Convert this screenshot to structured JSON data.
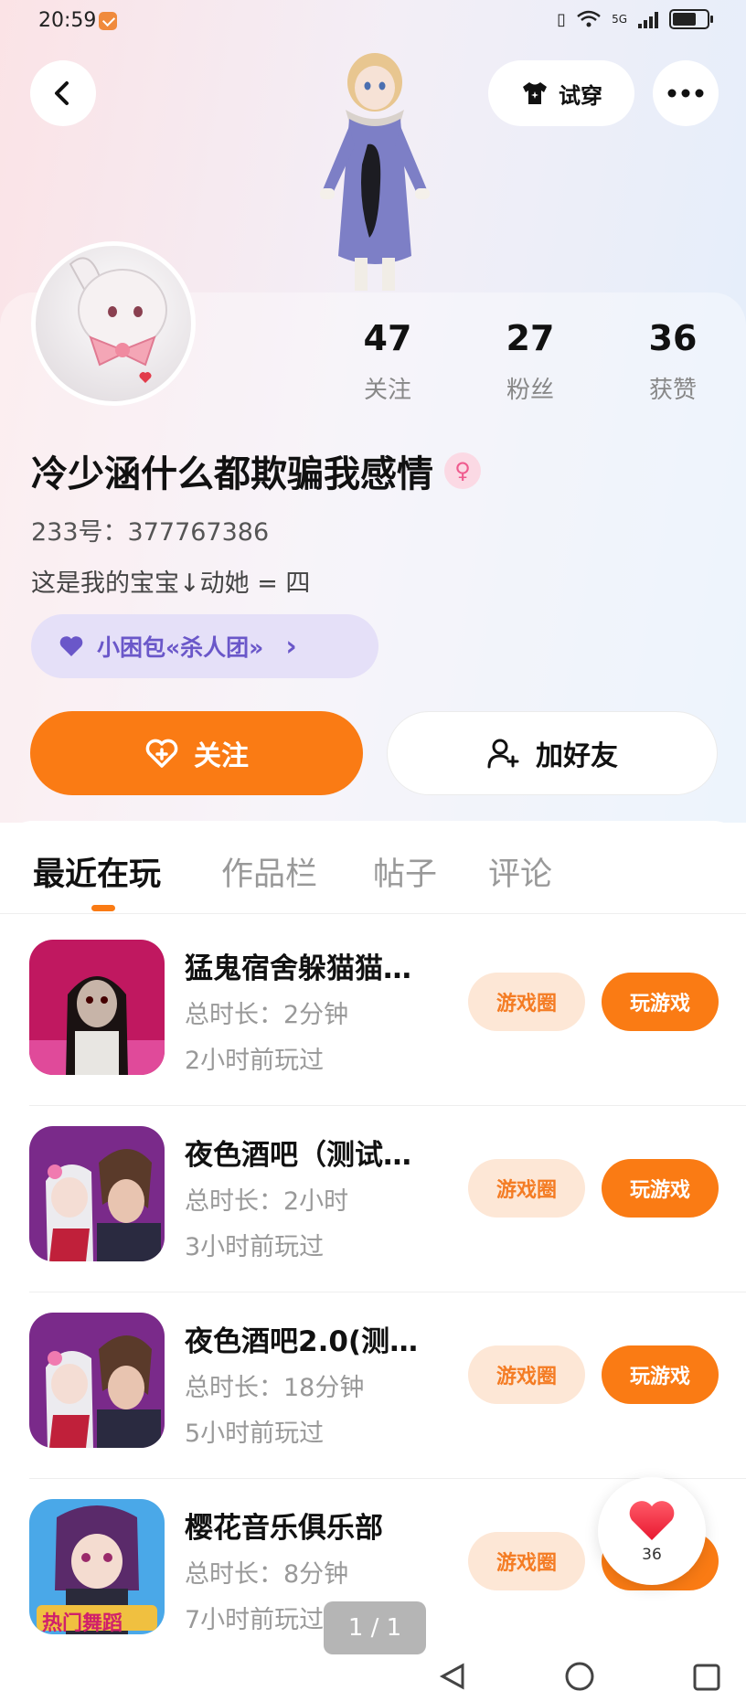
{
  "status_bar": {
    "time": "20:59",
    "network": "5G"
  },
  "header": {
    "tryon_label": "试穿",
    "icons": {
      "back": "back-chevron-icon",
      "tryon": "tshirt-icon",
      "more": "more-dots-icon"
    }
  },
  "profile": {
    "stats": [
      {
        "value": "47",
        "label": "关注"
      },
      {
        "value": "27",
        "label": "粉丝"
      },
      {
        "value": "36",
        "label": "获赞"
      }
    ],
    "username": "冷少涵什么都欺骗我感情",
    "gender_icon": "female-icon",
    "uid": "233号：377767386",
    "bio": "这是我的宝宝↓动她 = 四",
    "group": {
      "label": "小困包«杀人团»",
      "icon": "heart-icon",
      "chevron": "›"
    },
    "follow_label": "关注",
    "add_friend_label": "加好友"
  },
  "tabs": [
    {
      "label": "最近在玩",
      "active": true
    },
    {
      "label": "作品栏",
      "active": false
    },
    {
      "label": "帖子",
      "active": false
    },
    {
      "label": "评论",
      "active": false
    }
  ],
  "games": [
    {
      "title": "猛鬼宿舍躲猫猫…",
      "duration": "总时长：2分钟",
      "last_played": "2小时前玩过",
      "circle_label": "游戏圈",
      "play_label": "玩游戏"
    },
    {
      "title": "夜色酒吧（测试…",
      "duration": "总时长：2小时",
      "last_played": "3小时前玩过",
      "circle_label": "游戏圈",
      "play_label": "玩游戏"
    },
    {
      "title": "夜色酒吧2.0(测…",
      "duration": "总时长：18分钟",
      "last_played": "5小时前玩过",
      "circle_label": "游戏圈",
      "play_label": "玩游戏"
    },
    {
      "title": "樱花音乐俱乐部",
      "duration": "总时长：8分钟",
      "last_played": "7小时前玩过",
      "circle_label": "游戏圈",
      "play_label": "玩游戏"
    }
  ],
  "game_icon_text": "热门舞蹈",
  "like_float": {
    "count": "36",
    "icon": "heart-icon"
  },
  "page_indicator": "1 / 1",
  "colors": {
    "accent": "#fa7b14",
    "accent_light": "#fde7d6",
    "group_purple": "#6a57c9",
    "group_bg": "#e5e0f8"
  }
}
